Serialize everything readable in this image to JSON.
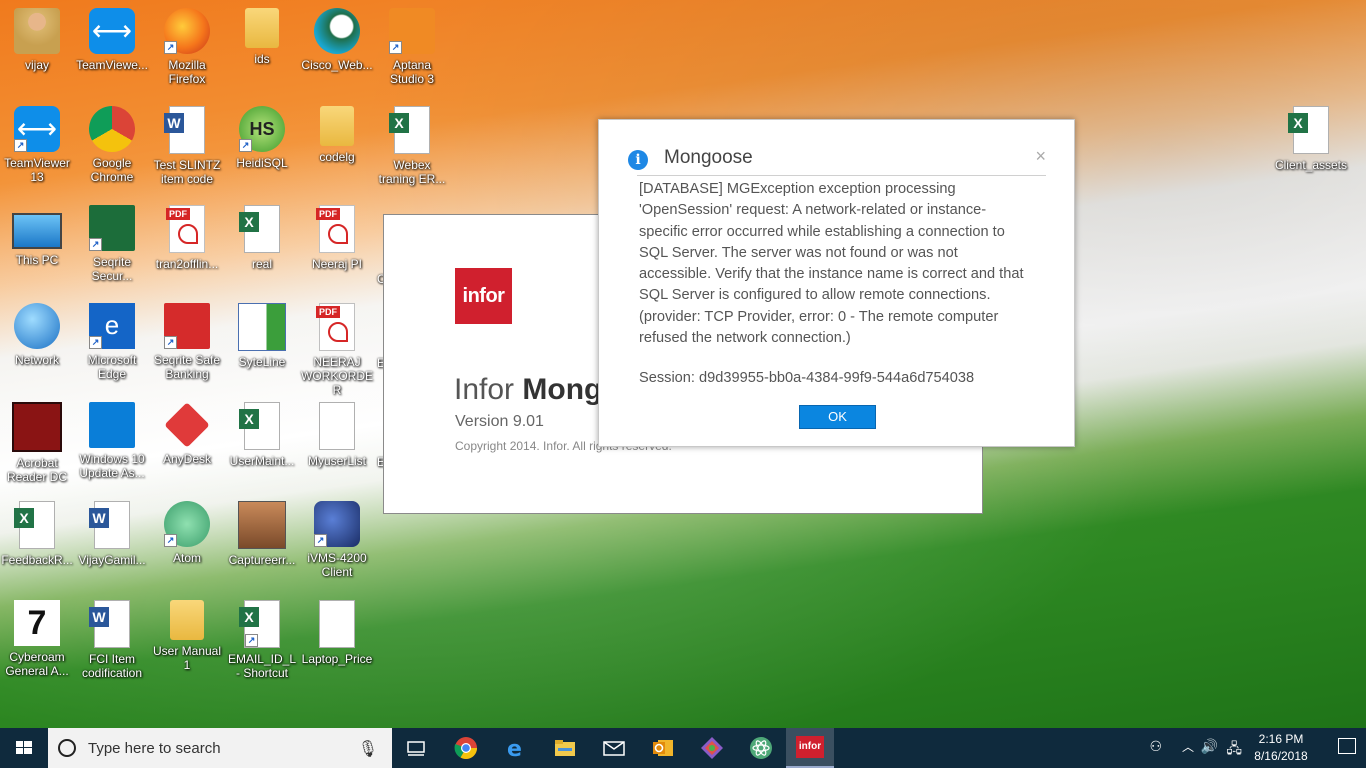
{
  "desktop": {
    "icons": [
      {
        "label": "vijay",
        "col": 0,
        "row": 0,
        "kind": "user",
        "shortcut": false
      },
      {
        "label": "TeamViewe...",
        "col": 1,
        "row": 0,
        "kind": "teamviewer",
        "shortcut": false
      },
      {
        "label": "Mozilla Firefox",
        "col": 2,
        "row": 0,
        "kind": "firefox",
        "shortcut": true
      },
      {
        "label": "ids",
        "col": 3,
        "row": 0,
        "kind": "folder",
        "shortcut": false
      },
      {
        "label": "Cisco_Web...",
        "col": 4,
        "row": 0,
        "kind": "webex",
        "shortcut": false
      },
      {
        "label": "Aptana Studio 3",
        "col": 5,
        "row": 0,
        "kind": "aptana",
        "shortcut": true
      },
      {
        "label": "TeamViewer 13",
        "col": 0,
        "row": 1,
        "kind": "teamviewer",
        "shortcut": true
      },
      {
        "label": "Google Chrome",
        "col": 1,
        "row": 1,
        "kind": "chrome",
        "shortcut": false
      },
      {
        "label": "Test SLINTZ item code",
        "col": 2,
        "row": 1,
        "kind": "word",
        "shortcut": false
      },
      {
        "label": "HeidiSQL",
        "col": 3,
        "row": 1,
        "kind": "heidisql",
        "shortcut": true
      },
      {
        "label": "codelg",
        "col": 4,
        "row": 1,
        "kind": "folder",
        "shortcut": false
      },
      {
        "label": "Webex traning ER...",
        "col": 5,
        "row": 1,
        "kind": "excel",
        "shortcut": false
      },
      {
        "label": "This PC",
        "col": 0,
        "row": 2,
        "kind": "pc",
        "shortcut": false
      },
      {
        "label": "Seqrite Secur...",
        "col": 1,
        "row": 2,
        "kind": "seqrite",
        "shortcut": true
      },
      {
        "label": "tran2offlin...",
        "col": 2,
        "row": 2,
        "kind": "pdf",
        "shortcut": false
      },
      {
        "label": "real",
        "col": 3,
        "row": 2,
        "kind": "excel",
        "shortcut": false
      },
      {
        "label": "Neeraj PI",
        "col": 4,
        "row": 2,
        "kind": "pdf",
        "shortcut": false
      },
      {
        "label": "Network",
        "col": 0,
        "row": 3,
        "kind": "network",
        "shortcut": false
      },
      {
        "label": "Microsoft Edge",
        "col": 1,
        "row": 3,
        "kind": "edge",
        "shortcut": true
      },
      {
        "label": "Seqrite Safe Banking",
        "col": 2,
        "row": 3,
        "kind": "safebank",
        "shortcut": true
      },
      {
        "label": "SyteLine",
        "col": 3,
        "row": 3,
        "kind": "syteline",
        "shortcut": false
      },
      {
        "label": "NEERAJ WORKORDER",
        "col": 4,
        "row": 3,
        "kind": "pdf",
        "shortcut": false
      },
      {
        "label": "Acrobat Reader DC",
        "col": 0,
        "row": 4,
        "kind": "acrobat",
        "shortcut": false
      },
      {
        "label": "Windows 10 Update As...",
        "col": 1,
        "row": 4,
        "kind": "winupdate",
        "shortcut": false
      },
      {
        "label": "AnyDesk",
        "col": 2,
        "row": 4,
        "kind": "anydesk",
        "shortcut": false
      },
      {
        "label": "UserMaint...",
        "col": 3,
        "row": 4,
        "kind": "excel",
        "shortcut": false
      },
      {
        "label": "MyuserList",
        "col": 4,
        "row": 4,
        "kind": "doc",
        "shortcut": false
      },
      {
        "label": "FeedbackR...",
        "col": 0,
        "row": 5,
        "kind": "excel",
        "shortcut": false
      },
      {
        "label": "VijayGamil...",
        "col": 1,
        "row": 5,
        "kind": "word",
        "shortcut": false
      },
      {
        "label": "Atom",
        "col": 2,
        "row": 5,
        "kind": "atom",
        "shortcut": true
      },
      {
        "label": "Captureerr...",
        "col": 3,
        "row": 5,
        "kind": "capture",
        "shortcut": false
      },
      {
        "label": "iVMS-4200 Client",
        "col": 4,
        "row": 5,
        "kind": "ivms",
        "shortcut": true
      },
      {
        "label": "Cyberoam General A...",
        "col": 0,
        "row": 6,
        "kind": "cyberoam",
        "shortcut": false
      },
      {
        "label": "FCI Item codification",
        "col": 1,
        "row": 6,
        "kind": "word",
        "shortcut": false
      },
      {
        "label": "User Manual 1",
        "col": 2,
        "row": 6,
        "kind": "folder",
        "shortcut": false
      },
      {
        "label": "EMAIL_ID_L - Shortcut",
        "col": 3,
        "row": 6,
        "kind": "excel",
        "shortcut": true
      },
      {
        "label": "Laptop_Price",
        "col": 4,
        "row": 6,
        "kind": "doc",
        "shortcut": false
      }
    ],
    "right_icon": {
      "label": "Client_assets",
      "kind": "excel"
    },
    "partial_labels": [
      "C",
      "E",
      "E"
    ]
  },
  "infor_splash": {
    "logo_text": "infor",
    "title_prefix": "Infor ",
    "title_bold": "Mongoose",
    "version": "Version 9.01",
    "copyright": "Copyright 2014. Infor. All rights reserved."
  },
  "dialog": {
    "title": "Mongoose",
    "info_glyph": "i",
    "close_glyph": "×",
    "message": "[DATABASE] MGException exception processing 'OpenSession' request: A network-related or instance-specific error occurred while establishing a connection to SQL Server. The server was not found or was not accessible. Verify that the instance name is correct and that SQL Server is configured to allow remote connections. (provider: TCP Provider, error: 0 - The remote computer refused the network connection.)",
    "session": "Session: d9d39955-bb0a-4384-99f9-544a6d754038",
    "ok_label": "OK"
  },
  "taskbar": {
    "search_placeholder": "Type here to search",
    "apps": [
      "task-view",
      "chrome",
      "edge",
      "file-explorer",
      "mail",
      "outlook",
      "git",
      "atom",
      "infor"
    ],
    "active_app": "infor",
    "infor_label": "infor",
    "time": "2:16 PM",
    "date": "8/16/2018"
  },
  "colors": {
    "dialog_ok": "#0b86e0",
    "infor_red": "#d0202e",
    "taskbar": "#0f2a3d"
  }
}
